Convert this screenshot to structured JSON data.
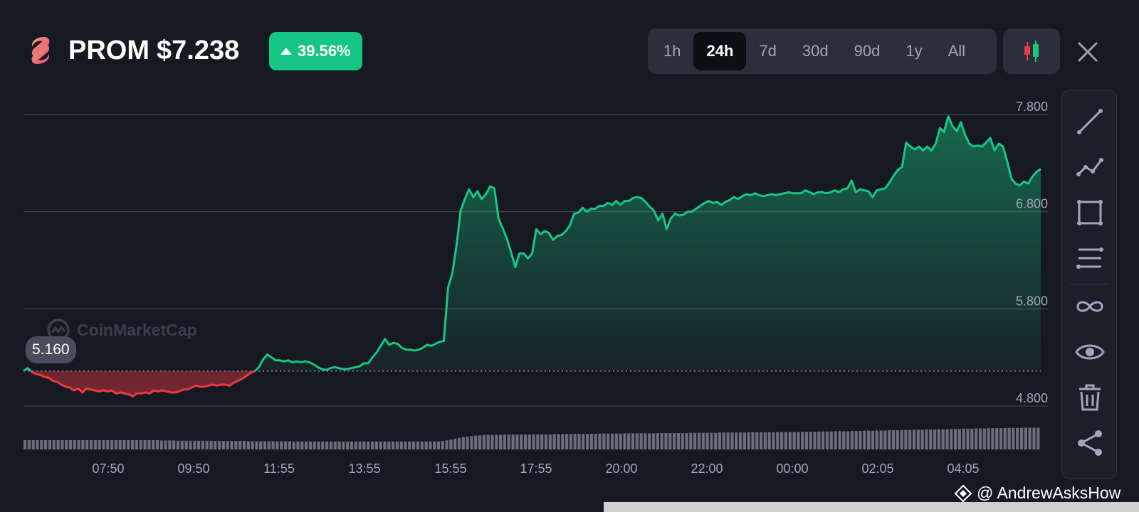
{
  "header": {
    "symbol": "PROM",
    "price": "$7.238",
    "change": "39.56%"
  },
  "ranges": [
    "1h",
    "24h",
    "7d",
    "30d",
    "90d",
    "1y",
    "All"
  ],
  "active_range": "24h",
  "colors": {
    "up": "#16c784",
    "down": "#ea3943",
    "background": "#171922",
    "panel": "#2b2f3c"
  },
  "icons": [
    "candlestick-icon",
    "close-icon",
    "trendline-icon",
    "polyline-icon",
    "rectangle-icon",
    "horizontal-lines-icon",
    "infinity-icon",
    "eye-icon",
    "trash-icon",
    "share-icon"
  ],
  "watermark": "CoinMarketCap",
  "open_price_label": "5.160",
  "credit": "@ AndrewAsksHow",
  "chart_data": {
    "type": "area",
    "x_ticks": [
      "07:50",
      "09:50",
      "11:55",
      "13:55",
      "15:55",
      "17:55",
      "20:00",
      "22:00",
      "00:00",
      "02:05",
      "04:05"
    ],
    "y_ticks": [
      "7.800",
      "6.800",
      "5.800",
      "4.800"
    ],
    "ylim": [
      4.8,
      7.8
    ],
    "baseline": 5.16,
    "grid": true,
    "series": [
      {
        "values": [
          5.16,
          5.19,
          5.15,
          5.13,
          5.12,
          5.1,
          5.09,
          5.06,
          5.05,
          5.02,
          5.0,
          4.99,
          4.96,
          4.98,
          4.94,
          4.98,
          4.97,
          4.96,
          4.95,
          4.96,
          4.95,
          4.96,
          4.93,
          4.94,
          4.93,
          4.92,
          4.9,
          4.93,
          4.93,
          4.94,
          4.93,
          4.96,
          4.95,
          4.96,
          4.95,
          4.94,
          4.94,
          4.95,
          4.97,
          4.97,
          4.99,
          5.01,
          5.0,
          5.0,
          5.01,
          5.02,
          5.01,
          5.02,
          5.02,
          5.01,
          5.04,
          5.06,
          5.08,
          5.11,
          5.14,
          5.16,
          5.2,
          5.28,
          5.33,
          5.3,
          5.27,
          5.27,
          5.26,
          5.27,
          5.25,
          5.26,
          5.25,
          5.26,
          5.25,
          5.23,
          5.2,
          5.18,
          5.17,
          5.19,
          5.2,
          5.19,
          5.18,
          5.18,
          5.19,
          5.2,
          5.21,
          5.24,
          5.24,
          5.3,
          5.35,
          5.42,
          5.49,
          5.43,
          5.45,
          5.44,
          5.4,
          5.38,
          5.38,
          5.37,
          5.38,
          5.4,
          5.43,
          5.42,
          5.44,
          5.46,
          5.47,
          6.02,
          6.16,
          6.45,
          6.81,
          6.93,
          7.03,
          6.95,
          7.01,
          6.93,
          6.98,
          7.06,
          7.04,
          6.73,
          6.63,
          6.52,
          6.38,
          6.23,
          6.37,
          6.37,
          6.32,
          6.37,
          6.62,
          6.57,
          6.6,
          6.58,
          6.51,
          6.55,
          6.56,
          6.6,
          6.66,
          6.78,
          6.79,
          6.84,
          6.8,
          6.83,
          6.83,
          6.86,
          6.86,
          6.89,
          6.87,
          6.91,
          6.87,
          6.91,
          6.91,
          6.94,
          6.95,
          6.94,
          6.9,
          6.85,
          6.81,
          6.71,
          6.78,
          6.62,
          6.73,
          6.78,
          6.76,
          6.77,
          6.8,
          6.8,
          6.83,
          6.86,
          6.89,
          6.91,
          6.89,
          6.9,
          6.87,
          6.9,
          6.92,
          6.95,
          6.93,
          6.96,
          6.98,
          6.97,
          6.99,
          6.97,
          6.96,
          6.97,
          6.98,
          6.97,
          6.98,
          6.99,
          7.0,
          6.99,
          6.99,
          6.99,
          7.02,
          7.0,
          6.98,
          7.0,
          7.0,
          6.99,
          7.0,
          7.02,
          7.0,
          7.03,
          7.04,
          7.12,
          7.0,
          7.03,
          7.02,
          7.01,
          6.95,
          7.02,
          7.03,
          7.04,
          7.1,
          7.17,
          7.23,
          7.26,
          7.51,
          7.47,
          7.44,
          7.47,
          7.43,
          7.47,
          7.43,
          7.5,
          7.66,
          7.62,
          7.78,
          7.68,
          7.63,
          7.72,
          7.59,
          7.5,
          7.47,
          7.48,
          7.47,
          7.51,
          7.56,
          7.43,
          7.5,
          7.47,
          7.32,
          7.14,
          7.09,
          7.07,
          7.11,
          7.09,
          7.16,
          7.21,
          7.24
        ]
      }
    ],
    "volume": [
      0.36,
      0.36,
      0.36,
      0.36,
      0.36,
      0.36,
      0.36,
      0.36,
      0.36,
      0.36,
      0.36,
      0.36,
      0.36,
      0.36,
      0.36,
      0.36,
      0.36,
      0.36,
      0.36,
      0.36,
      0.36,
      0.36,
      0.36,
      0.36,
      0.36,
      0.36,
      0.36,
      0.36,
      0.36,
      0.36,
      0.36,
      0.36,
      0.36,
      0.35,
      0.35,
      0.35,
      0.35,
      0.34,
      0.34,
      0.34,
      0.34,
      0.34,
      0.34,
      0.34,
      0.34,
      0.34,
      0.33,
      0.33,
      0.33,
      0.33,
      0.33,
      0.33,
      0.33,
      0.33,
      0.32,
      0.32,
      0.32,
      0.32,
      0.32,
      0.32,
      0.32,
      0.32,
      0.32,
      0.32,
      0.32,
      0.31,
      0.31,
      0.31,
      0.31,
      0.31,
      0.31,
      0.31,
      0.31,
      0.31,
      0.31,
      0.31,
      0.31,
      0.31,
      0.31,
      0.31,
      0.31,
      0.31,
      0.31,
      0.31,
      0.31,
      0.31,
      0.31,
      0.31,
      0.31,
      0.31,
      0.31,
      0.31,
      0.31,
      0.31,
      0.31,
      0.31,
      0.31,
      0.31,
      0.31,
      0.31,
      0.31,
      0.33,
      0.35,
      0.38,
      0.42,
      0.45,
      0.48,
      0.5,
      0.52,
      0.54,
      0.55,
      0.56,
      0.57,
      0.57,
      0.57,
      0.57,
      0.58,
      0.58,
      0.58,
      0.58,
      0.58,
      0.58,
      0.58,
      0.59,
      0.59,
      0.59,
      0.59,
      0.59,
      0.6,
      0.6,
      0.6,
      0.6,
      0.6,
      0.61,
      0.61,
      0.61,
      0.61,
      0.61,
      0.61,
      0.62,
      0.62,
      0.62,
      0.62,
      0.62,
      0.62,
      0.63,
      0.63,
      0.63,
      0.63,
      0.63,
      0.63,
      0.63,
      0.63,
      0.64,
      0.64,
      0.64,
      0.64,
      0.64,
      0.64,
      0.64,
      0.64,
      0.65,
      0.65,
      0.65,
      0.65,
      0.65,
      0.65,
      0.65,
      0.66,
      0.66,
      0.66,
      0.66,
      0.66,
      0.66,
      0.66,
      0.67,
      0.67,
      0.67,
      0.67,
      0.67,
      0.67,
      0.67,
      0.68,
      0.68,
      0.68,
      0.68,
      0.68,
      0.68,
      0.69,
      0.69,
      0.69,
      0.69,
      0.7,
      0.7,
      0.7,
      0.7,
      0.71,
      0.71,
      0.71,
      0.71,
      0.72,
      0.72,
      0.72,
      0.73,
      0.73,
      0.73,
      0.74,
      0.74,
      0.74,
      0.75,
      0.75,
      0.75,
      0.76,
      0.76,
      0.76,
      0.77,
      0.77,
      0.77,
      0.78,
      0.78,
      0.78,
      0.79,
      0.79,
      0.79,
      0.8,
      0.8,
      0.8,
      0.81,
      0.81,
      0.81,
      0.82,
      0.82,
      0.82,
      0.83,
      0.83,
      0.83,
      0.83,
      0.84,
      0.84,
      0.84,
      0.84,
      0.84,
      0.85,
      0.85,
      0.85,
      0.85
    ]
  }
}
